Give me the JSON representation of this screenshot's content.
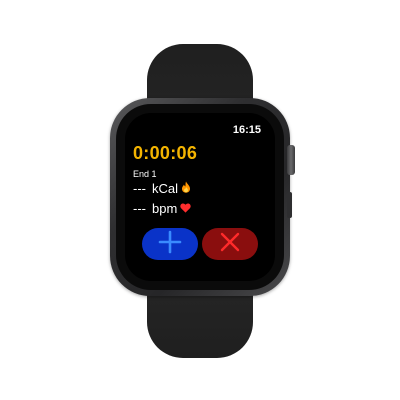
{
  "watch": {
    "time": "16:15",
    "timer": "0:00:06",
    "end_label": "End 1",
    "calories": {
      "value": "---",
      "unit": "kCal",
      "icon": "flame-icon"
    },
    "heart_rate": {
      "value": "---",
      "unit": "bpm",
      "icon": "heart-icon"
    },
    "buttons": {
      "add": {
        "icon": "plus-icon",
        "color": "#0a33c8"
      },
      "cancel": {
        "icon": "close-icon",
        "color": "#8a0e0e"
      }
    }
  },
  "colors": {
    "timer": "#f4b400",
    "add_icon": "#3a8bff",
    "cancel_icon": "#ff2a2a",
    "heart": "#ff2d2d",
    "flame": "#ff9500"
  }
}
